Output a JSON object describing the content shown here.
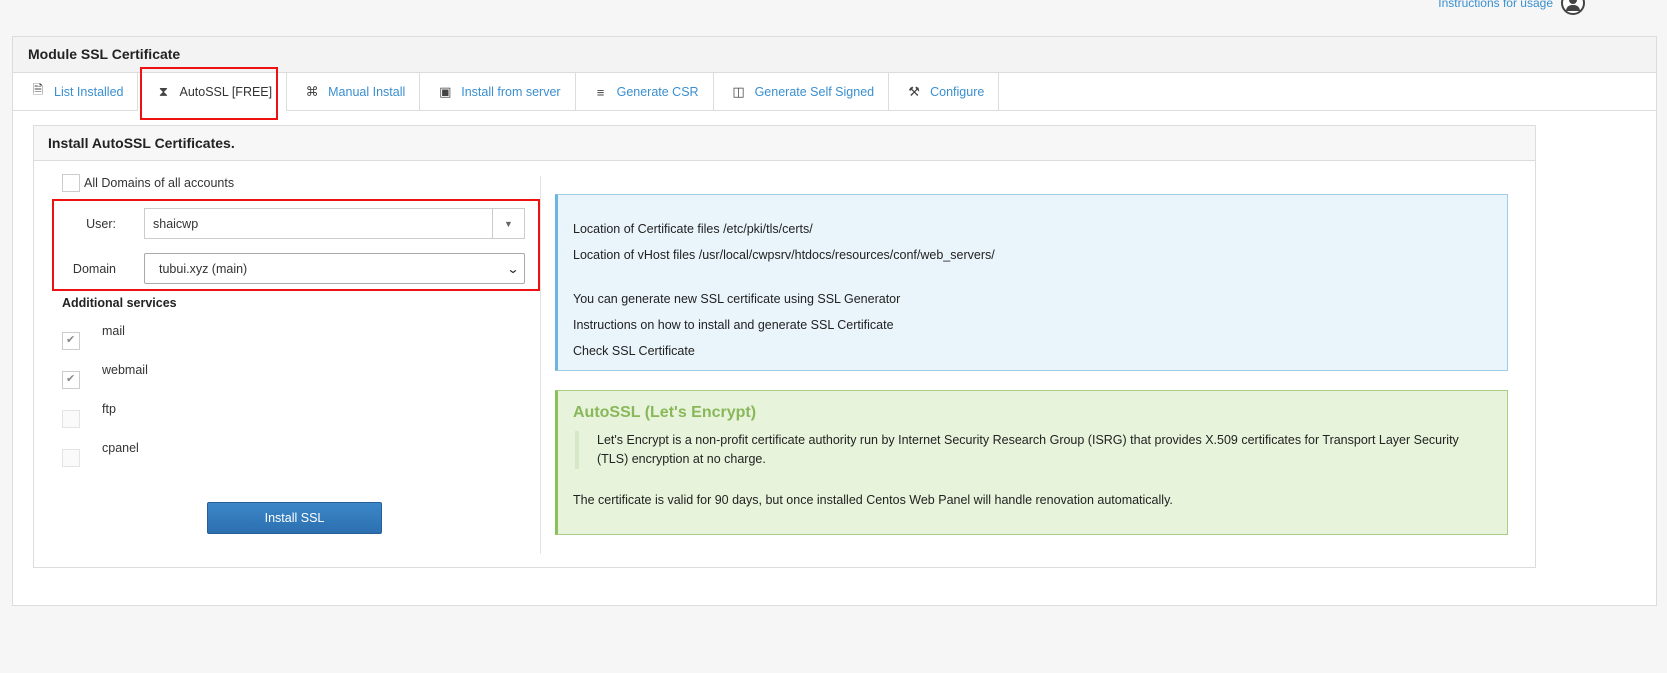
{
  "top": {
    "instructions_link": "Instructions for usage"
  },
  "module": {
    "title": "Module SSL Certificate"
  },
  "tabs": [
    {
      "label": "List Installed",
      "icon": "document-icon"
    },
    {
      "label": "AutoSSL [FREE]",
      "icon": "tag-icon"
    },
    {
      "label": "Manual Install",
      "icon": "command-icon"
    },
    {
      "label": "Install from server",
      "icon": "briefcase-icon"
    },
    {
      "label": "Generate CSR",
      "icon": "sliders-icon"
    },
    {
      "label": "Generate Self Signed",
      "icon": "certificate-icon"
    },
    {
      "label": "Configure",
      "icon": "tools-icon"
    }
  ],
  "panel": {
    "title": "Install AutoSSL Certificates."
  },
  "form": {
    "all_domains_label": "All Domains of all accounts",
    "user_label": "User:",
    "user_value": "shaicwp",
    "domain_label": "Domain",
    "domain_value": "tubui.xyz (main)",
    "additional_services_label": "Additional services",
    "services": [
      {
        "label": "mail",
        "checked": true
      },
      {
        "label": "webmail",
        "checked": true
      },
      {
        "label": "ftp",
        "checked": false
      },
      {
        "label": "cpanel",
        "checked": false
      }
    ],
    "install_button": "Install SSL"
  },
  "info": {
    "cert_location": "Location of Certificate files /etc/pki/tls/certs/",
    "vhost_location": "Location of vHost files /usr/local/cwpsrv/htdocs/resources/conf/web_servers/",
    "generate_text": "You can generate new SSL certificate using SSL Generator",
    "instructions_text": "Instructions on how to install and generate SSL Certificate",
    "check_text": "Check SSL Certificate"
  },
  "letsencrypt": {
    "title": "AutoSSL (Let's Encrypt)",
    "description": "Let's Encrypt is a non-profit certificate authority run by Internet Security Research Group (ISRG) that provides X.509 certificates for Transport Layer Security (TLS) encryption at no charge.",
    "footer": "The certificate is valid for 90 days, but once installed Centos Web Panel will handle renovation automatically."
  },
  "colors": {
    "link": "#3a8fd0",
    "highlight": "#e11111",
    "info_bg": "#e9f4fb",
    "success_bg": "#e7f3db",
    "button": "#2c70b0"
  }
}
